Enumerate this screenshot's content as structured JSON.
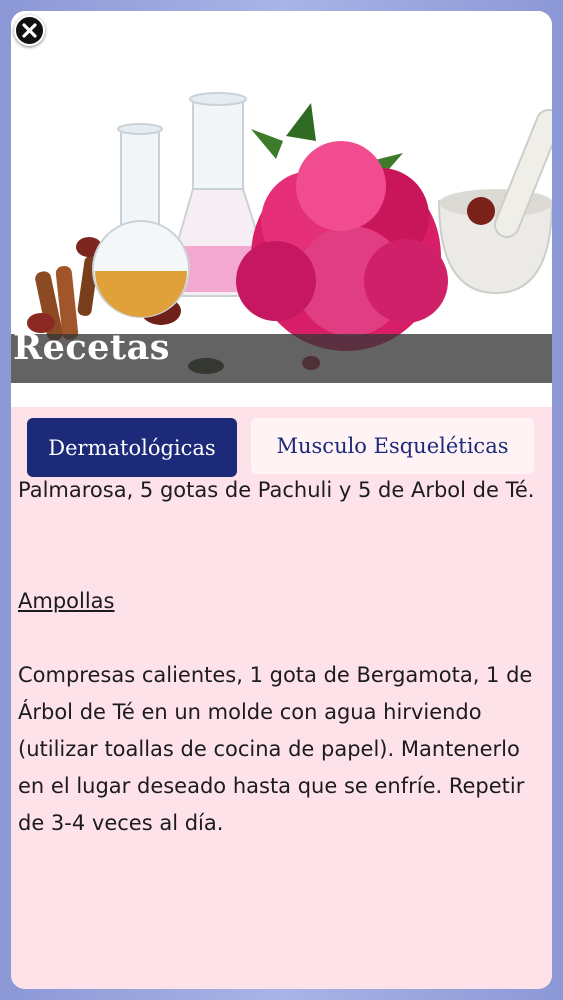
{
  "header": {
    "title": "Recetas",
    "close_icon": "close-icon"
  },
  "tabs": [
    {
      "label": "Dermatológicas",
      "active": true
    },
    {
      "label": "Musculo Esqueléticas",
      "active": false
    }
  ],
  "content": {
    "intro": "Palmarosa, 5 gotas de Pachuli y 5 de Arbol de Té.",
    "section_heading": "Ampollas",
    "section_body": "Compresas calientes, 1 gota de Bergamota, 1 de Árbol de Té en un molde con agua hirviendo (utilizar toallas de cocina de papel). Mantenerlo en el lugar deseado hasta que se enfríe. Repetir de 3-4 veces al día."
  },
  "colors": {
    "tab_active_bg": "#1d2a7a",
    "content_bg": "#fde2ea",
    "frame_bg": "#a9b3e6"
  }
}
